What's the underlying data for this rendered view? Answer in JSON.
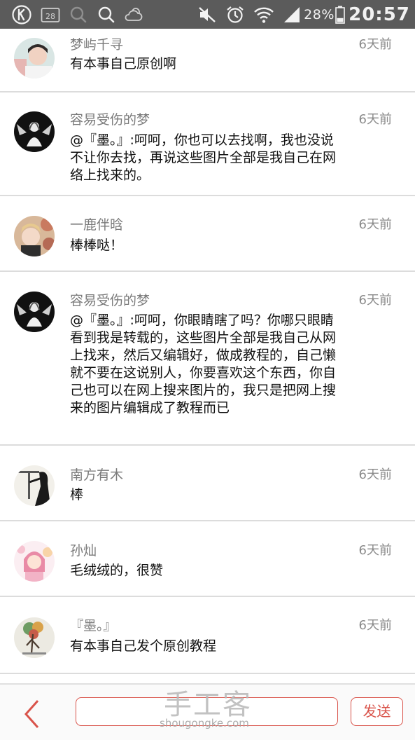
{
  "status_bar": {
    "calendar_day": "28",
    "battery_percent": "28%",
    "battery_level": 0.28,
    "time": "20:57"
  },
  "comments": [
    {
      "name": "梦屿千寻",
      "time": "6天前",
      "text": "有本事自己原创啊",
      "avatar": "avatar-boy-photo"
    },
    {
      "name": "容易受伤的梦",
      "time": "6天前",
      "text": "@『墨。』:呵呵，你也可以去找啊，我也没说不让你去找，再说这些图片全部是我自己在网络上找来的。",
      "avatar": "avatar-dark-angel"
    },
    {
      "name": "一鹿伴晗",
      "time": "6天前",
      "text": "棒棒哒！",
      "avatar": "avatar-boy-flowers"
    },
    {
      "name": "容易受伤的梦",
      "time": "6天前",
      "text": "@『墨。』:呵呵，你眼睛瞎了吗？你哪只眼睛看到我是转载的，这些图片全部是我自己从网上找来，然后又编辑好，做成教程的，自己懒就不要在这说别人，你要喜欢这个东西，你自己也可以在网上搜来图片的，我只是把网上搜来的图片编辑成了教程而已",
      "avatar": "avatar-dark-angel"
    },
    {
      "name": "南方有木",
      "time": "6天前",
      "text": "棒",
      "avatar": "avatar-silhouette"
    },
    {
      "name": "孙灿",
      "time": "6天前",
      "text": "毛绒绒的，很赞",
      "avatar": "avatar-anime-girl"
    },
    {
      "name": "『墨。』",
      "time": "6天前",
      "text": "有本事自己发个原创教程",
      "avatar": "avatar-tree"
    }
  ],
  "bottom_bar": {
    "input_placeholder": "",
    "send_label": "发送",
    "watermark": "手工客",
    "watermark_url": "shougongke.com"
  },
  "colors": {
    "accent": "#d9534a",
    "status_bar": "#5b5b5b"
  }
}
